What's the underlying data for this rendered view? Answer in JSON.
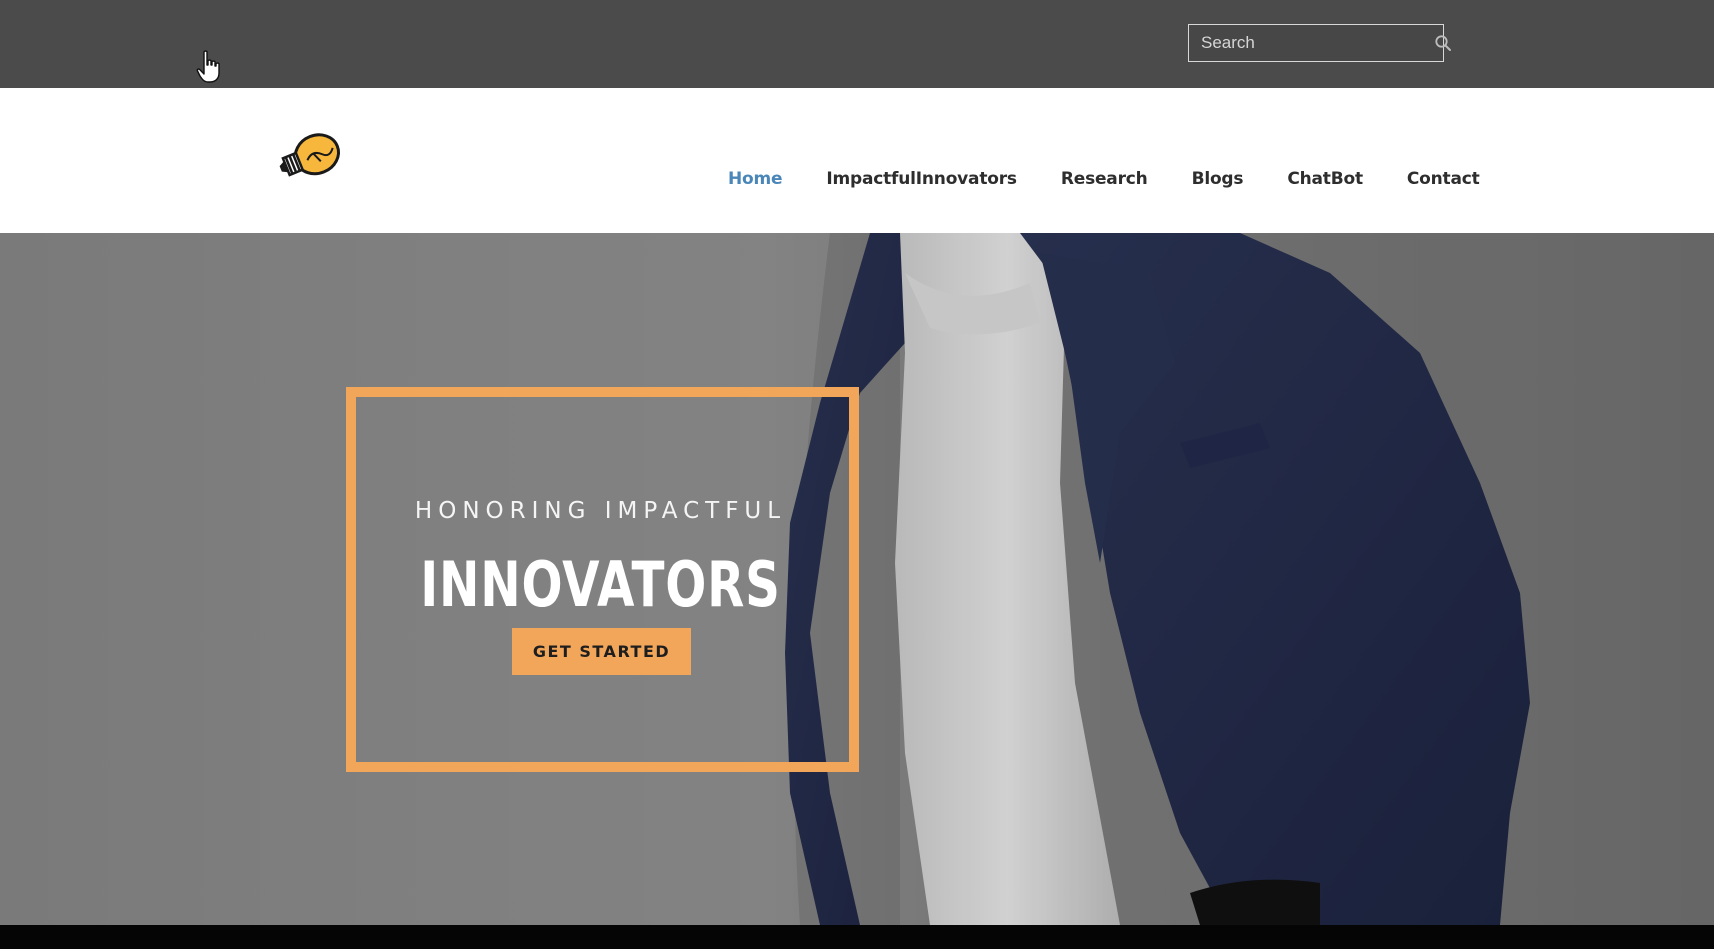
{
  "topbar": {
    "search": {
      "placeholder": "Search",
      "icon": "search-icon"
    }
  },
  "header": {
    "logo": {
      "icon": "lightbulb-logo-icon",
      "colors": {
        "bulb": "#f6b73c",
        "outline": "#1a1a1a"
      }
    },
    "nav": [
      {
        "label": "Home",
        "active": true
      },
      {
        "label": "ImpactfulInnovators",
        "active": false
      },
      {
        "label": "Research",
        "active": false
      },
      {
        "label": "Blogs",
        "active": false
      },
      {
        "label": "ChatBot",
        "active": false
      },
      {
        "label": "Contact",
        "active": false
      }
    ]
  },
  "hero": {
    "kicker": "HONORING IMPACTFUL",
    "headline": "INNOVATORS",
    "cta_label": "GET STARTED"
  },
  "colors": {
    "accent": "#f2a65a",
    "nav_active": "#4a86b8",
    "topbar": "#4b4b4b"
  }
}
